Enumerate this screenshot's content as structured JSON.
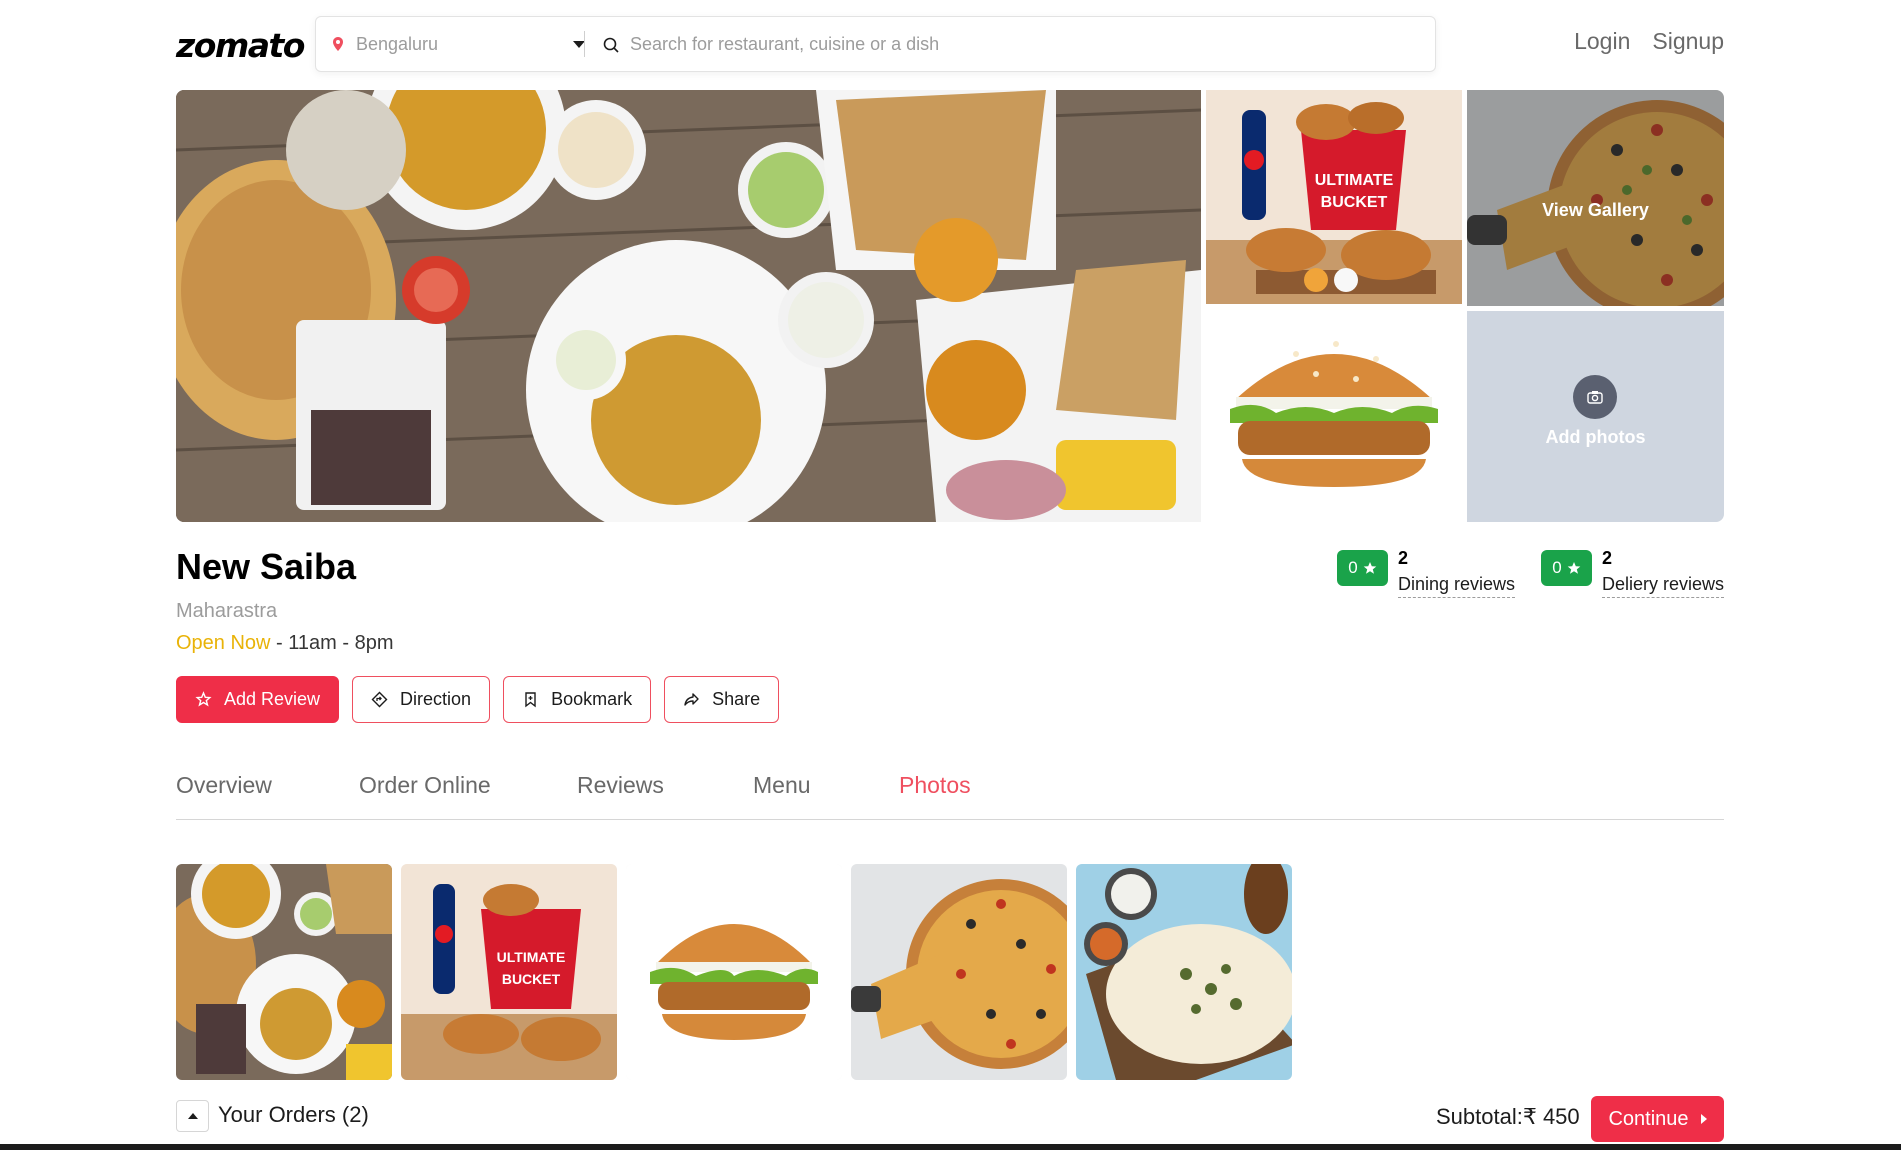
{
  "header": {
    "logo": "zomato",
    "location": "Bengaluru",
    "search_placeholder": "Search for restaurant, cuisine or a dish",
    "login": "Login",
    "signup": "Signup"
  },
  "gallery": {
    "view_gallery": "View Gallery",
    "add_photos": "Add photos"
  },
  "restaurant": {
    "name": "New Saiba",
    "location": "Maharastra",
    "open_status": "Open Now",
    "hours": " - 11am - 8pm"
  },
  "ratings": [
    {
      "value": "0",
      "count": "2",
      "label": "Dining reviews"
    },
    {
      "value": "0",
      "count": "2",
      "label": "Deliery reviews"
    }
  ],
  "actions": {
    "add_review": "Add Review",
    "direction": "Direction",
    "bookmark": "Bookmark",
    "share": "Share"
  },
  "tabs": [
    {
      "label": "Overview",
      "active": false
    },
    {
      "label": "Order Online",
      "active": false
    },
    {
      "label": "Reviews",
      "active": false
    },
    {
      "label": "Menu",
      "active": false
    },
    {
      "label": "Photos",
      "active": true
    }
  ],
  "photos": [
    "thali",
    "chicken-bucket",
    "burger",
    "pizza",
    "rice-plate"
  ],
  "orders": {
    "label": "Your Orders (2)",
    "subtotal": "Subtotal:₹ 450",
    "continue": "Continue"
  },
  "colors": {
    "brand": "#ef4f5f",
    "primary_button": "#ef2e48",
    "rating_green": "#1aa34a",
    "open_yellow": "#e9b308"
  }
}
